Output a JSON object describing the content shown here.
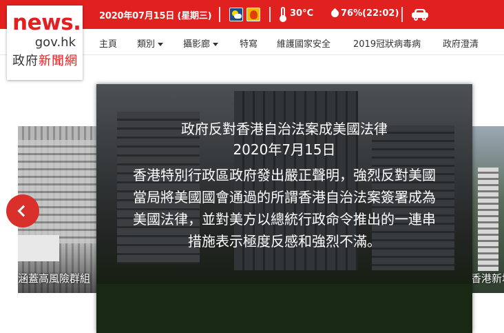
{
  "topbar": {
    "date": "2020年07月15日 (星期三)",
    "weather_icons": [
      "sunny-periods-icon",
      "very-hot-weather-icon"
    ],
    "temperature": "30°C",
    "humidity": "76%(22:02)",
    "traffic_icon": "car-icon",
    "bg_color": "#e02120"
  },
  "logo": {
    "line1": "news.",
    "line2": "gov.hk",
    "line3_a": "政府",
    "line3_b": "新聞網"
  },
  "nav": {
    "items": [
      {
        "label": "主頁",
        "dropdown": false
      },
      {
        "label": "類別",
        "dropdown": true
      },
      {
        "label": "攝影廊",
        "dropdown": true
      },
      {
        "label": "特寫",
        "dropdown": false
      },
      {
        "label": "維護國家安全",
        "dropdown": false
      },
      {
        "label": "2019冠狀病毒病",
        "dropdown": false
      },
      {
        "label": "政府澄清",
        "dropdown": false
      }
    ]
  },
  "carousel": {
    "prev_caption": "涵蓋高風險群組",
    "next_caption": "香港新地",
    "main": {
      "title": "政府反對香港自治法案成美國法律",
      "date": "2020年7月15日",
      "body": "香港特別行政區政府發出嚴正聲明，強烈反對美國當局將美國國會通過的所謂香港自治法案簽署成為美國法律，並對美方以總統行政命令推出的一連串措施表示極度反感和強烈不滿。"
    },
    "prev_arrow_icon": "chevron-left-icon"
  }
}
